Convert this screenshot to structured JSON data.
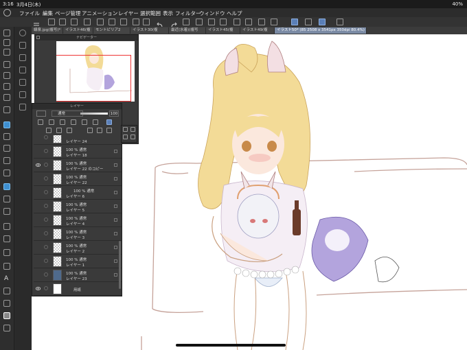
{
  "status": {
    "time": "3:16",
    "date": "3月4日(木)",
    "battery": "40%"
  },
  "menu": [
    "ファイル",
    "編集",
    "ページ管理",
    "アニメーション",
    "レイヤー",
    "選択範囲",
    "表示",
    "フィルター",
    "ウィンドウ",
    "ヘルプ"
  ],
  "tabs": [
    {
      "label": "線泉.jpg(複写)*"
    },
    {
      "label": "イラスト46(複"
    },
    {
      "label": "モントピリア2"
    },
    {
      "label": "イラスト30(複"
    },
    {
      "label": "最近(水着)(複写"
    },
    {
      "label": "イラスト45(複"
    },
    {
      "label": "イラスト49(複"
    },
    {
      "label": "イラスト50* (85 2508 x 3541px 350dpi 80.4%)",
      "active": true
    }
  ],
  "navigator": {
    "title": "ナビゲーター"
  },
  "layers_panel": {
    "title": "レイヤー",
    "blend_mode": "通常",
    "opacity": "100",
    "layers": [
      {
        "blend": "",
        "name": "レイヤー 24",
        "visible": false,
        "partial": true
      },
      {
        "blend": "100 % 通常",
        "name": "レイヤー 18",
        "visible": false
      },
      {
        "blend": "100 % 通常",
        "name": "レイヤー 22 のコピー",
        "visible": true
      },
      {
        "blend": "100 % 通常",
        "name": "レイヤー 22",
        "visible": false
      },
      {
        "blend": "100 % 通常",
        "name": "レイヤー 6",
        "visible": false
      },
      {
        "blend": "100 % 通常",
        "name": "レイヤー 5",
        "visible": false
      },
      {
        "blend": "100 % 通常",
        "name": "レイヤー 4",
        "visible": false
      },
      {
        "blend": "100 % 通常",
        "name": "レイヤー 3",
        "visible": false
      },
      {
        "blend": "100 % 通常",
        "name": "レイヤー 2",
        "visible": false
      },
      {
        "blend": "100 % 通常",
        "name": "レイヤー 1",
        "visible": false
      },
      {
        "blend": "100 % 通常",
        "name": "レイヤー 23",
        "visible": false
      },
      {
        "blend": "",
        "name": "用紙",
        "visible": true
      }
    ]
  },
  "colors": {
    "accent": "#5a7fb8",
    "tool_selected": "#3e8fd0",
    "canvas_bg": "#ffffff"
  },
  "icons": {
    "left_tools": [
      "zoom-icon",
      "pen-icon",
      "lasso-icon",
      "hand-icon",
      "operation-icon",
      "move-icon",
      "magic-wand-icon",
      "eyedropper-icon",
      "pen-tool-icon",
      "pencil-icon",
      "brush-icon",
      "airbrush-icon",
      "decoration-icon",
      "eraser-icon",
      "blend-icon",
      "fill-icon",
      "gradient-icon",
      "figure-icon",
      "frame-icon",
      "balloon-icon",
      "text-icon",
      "line-correct-icon",
      "color-icon"
    ]
  }
}
